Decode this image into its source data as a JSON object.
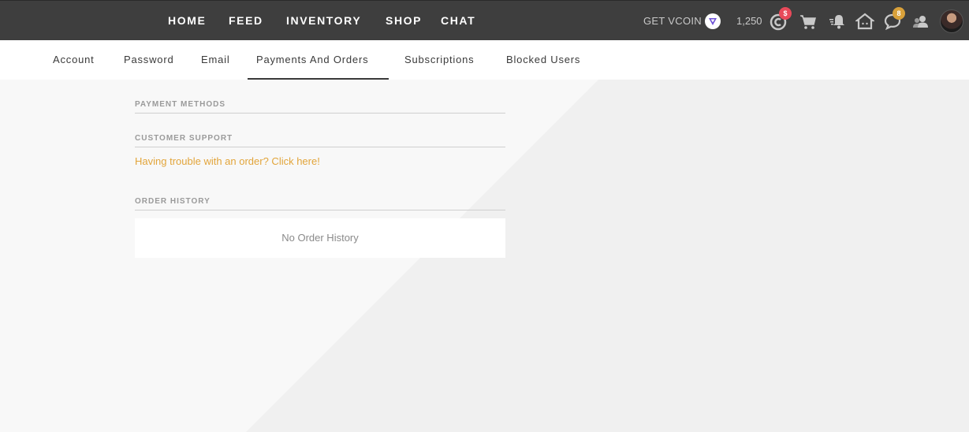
{
  "topbar": {
    "nav": [
      "HOME",
      "FEED",
      "INVENTORY",
      "SHOP",
      "CHAT"
    ],
    "get_vcoin_label": "GET VCOIN",
    "coin_count": "1,250",
    "badges": {
      "coin": "$",
      "chat": "8"
    },
    "icons": [
      "vcoin-icon",
      "coin-icon",
      "cart-icon",
      "notification-bell-icon",
      "home-icon",
      "chat-bubble-icon",
      "friends-icon"
    ],
    "colors": {
      "bar": "#3e3e3e",
      "badge_red": "#e84a5a",
      "badge_gold": "#d9a13a"
    }
  },
  "subnav": {
    "tabs": [
      "Account",
      "Password",
      "Email",
      "Payments And Orders",
      "Subscriptions",
      "Blocked Users"
    ],
    "active": "Payments And Orders"
  },
  "sections": {
    "payment_methods": "PAYMENT METHODS",
    "customer_support": "CUSTOMER SUPPORT",
    "support_link": "Having trouble with an order? Click here!",
    "order_history": "ORDER HISTORY",
    "no_history": "No Order History"
  },
  "colors": {
    "accent_link": "#e2a53b"
  }
}
